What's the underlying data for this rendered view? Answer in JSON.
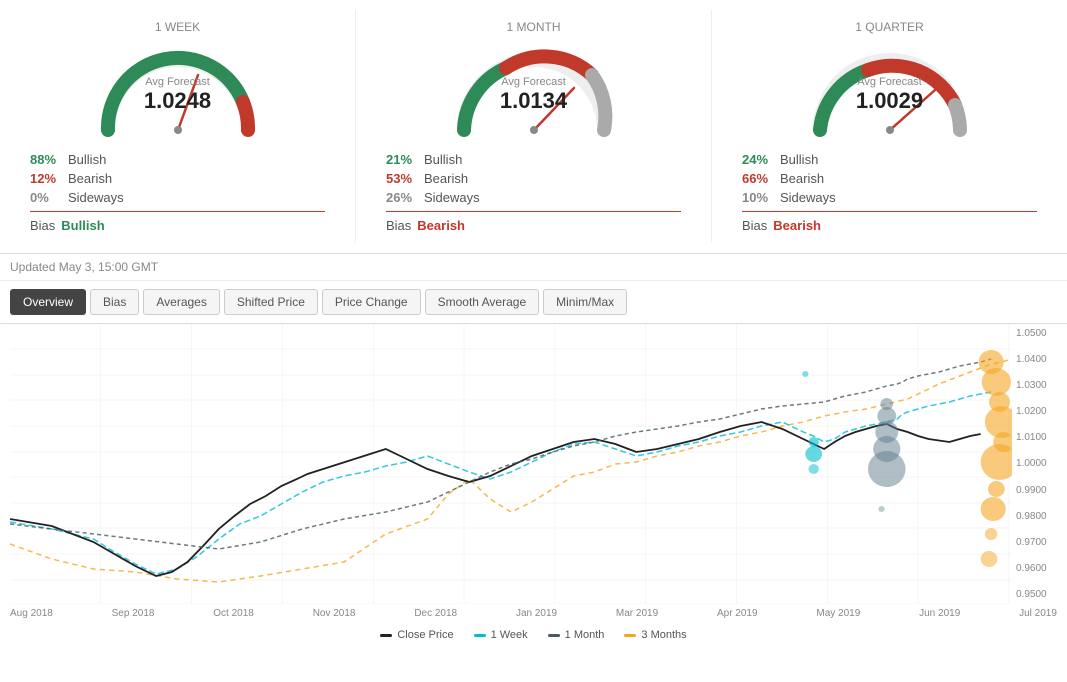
{
  "panels": [
    {
      "id": "week",
      "period": "1 WEEK",
      "avg_label": "Avg Forecast",
      "avg_value": "1.0248",
      "bullish_pct": "88%",
      "bearish_pct": "12%",
      "sideways_pct": "0%",
      "bias": "Bullish",
      "bias_class": "bullish",
      "gauge_green_end": 220,
      "gauge_red_end": 20,
      "gauge_gray_end": 0,
      "needle_angle": -30
    },
    {
      "id": "month",
      "period": "1 MONTH",
      "avg_label": "Avg Forecast",
      "avg_value": "1.0134",
      "bullish_pct": "21%",
      "bearish_pct": "53%",
      "sideways_pct": "26%",
      "bias": "Bearish",
      "bias_class": "bearish",
      "needle_angle": 30
    },
    {
      "id": "quarter",
      "period": "1 QUARTER",
      "avg_label": "Avg Forecast",
      "avg_value": "1.0029",
      "bullish_pct": "24%",
      "bearish_pct": "66%",
      "sideways_pct": "10%",
      "bias": "Bearish",
      "bias_class": "bearish",
      "needle_angle": 40
    }
  ],
  "updated": "Updated May 3, 15:00 GMT",
  "tabs": [
    {
      "label": "Overview",
      "active": true
    },
    {
      "label": "Bias",
      "active": false
    },
    {
      "label": "Averages",
      "active": false
    },
    {
      "label": "Shifted Price",
      "active": false
    },
    {
      "label": "Price Change",
      "active": false
    },
    {
      "label": "Smooth Average",
      "active": false
    },
    {
      "label": "Minim/Max",
      "active": false
    }
  ],
  "y_axis": [
    "1.0500",
    "1.0400",
    "1.0300",
    "1.0200",
    "1.0100",
    "1.0000",
    "0.9900",
    "0.9800",
    "0.9700",
    "0.9600",
    "0.9500"
  ],
  "x_axis": [
    "Aug 2018",
    "Sep 2018",
    "Oct 2018",
    "Nov 2018",
    "Dec 2018",
    "Jan 2019",
    "Mar 2019",
    "Apr 2019",
    "May 2019",
    "Jun 2019",
    "Jul 2019"
  ],
  "legend": [
    {
      "label": "Close Price",
      "class": "close"
    },
    {
      "label": "1 Week",
      "class": "week"
    },
    {
      "label": "1 Month",
      "class": "month"
    },
    {
      "label": "3 Months",
      "class": "three-months"
    }
  ]
}
